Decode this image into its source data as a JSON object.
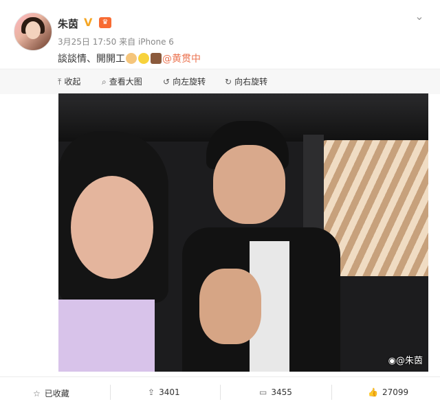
{
  "header": {
    "username": "朱茵",
    "verified_icon": "verified-v-icon",
    "vip_icon": "vip-crown-icon",
    "timestamp": "3月25日 17:50",
    "source": "来自 iPhone 6"
  },
  "post": {
    "text": "談談情、開開工",
    "emojis": [
      "hand-sign-emoji",
      "sun-emoji",
      "couple-emoji"
    ],
    "mention": "@黄贯中"
  },
  "toolbar": {
    "collapse": "收起",
    "view_large": "查看大图",
    "rotate_left": "向左旋转",
    "rotate_right": "向右旋转"
  },
  "photo": {
    "watermark": "@朱茵"
  },
  "actions": {
    "favorite": "已收藏",
    "repost_count": "3401",
    "comment_count": "3455",
    "like_count": "27099"
  },
  "colors": {
    "mention": "#eb7350",
    "vip": "#f86b32",
    "verified": "#f5a623"
  }
}
